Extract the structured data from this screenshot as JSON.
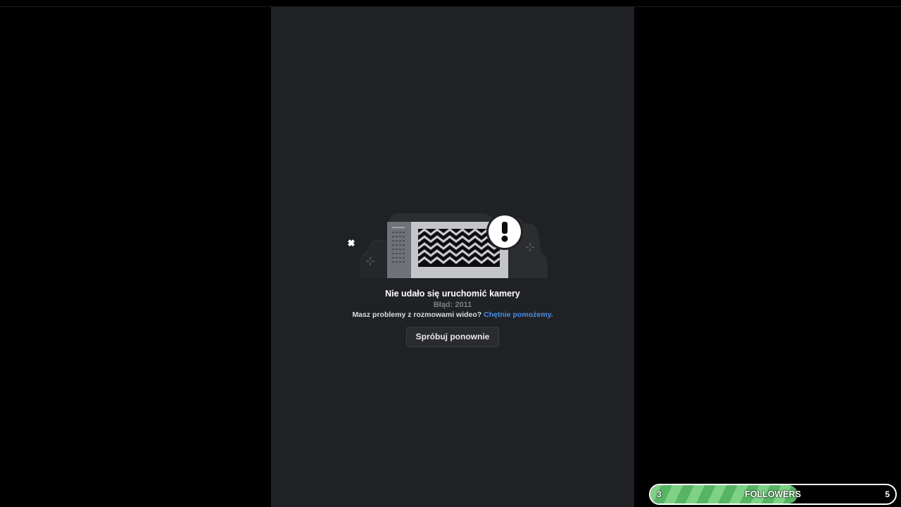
{
  "error": {
    "title": "Nie udało się uruchomić kamery",
    "code": "Błąd: 2011",
    "help_text": "Masz problemy z rozmowami wideo?",
    "help_link": "Chętnie pomożemy.",
    "retry_label": "Spróbuj ponownie",
    "illustration_icon": "broken-camera-illustration"
  },
  "followers": {
    "label": "FOLLOWERS",
    "current": "3",
    "goal": "5",
    "progress_fraction": 0.6,
    "fill_color": "#7ed185",
    "stripe_color": "#56b463"
  },
  "colors": {
    "panel_bg": "#202124",
    "link": "#4a8ee8"
  }
}
